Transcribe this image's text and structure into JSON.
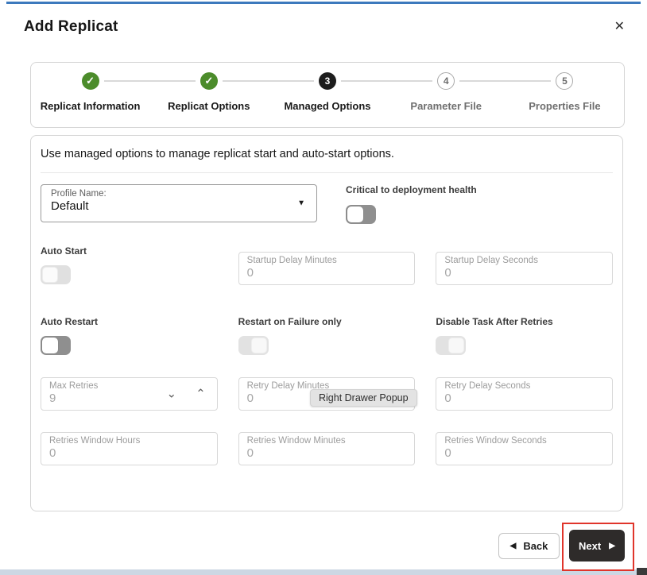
{
  "header": {
    "title": "Add Replicat"
  },
  "icons": {
    "close": "✕",
    "check": "✓",
    "dropdown_arrow": "▼",
    "chevron_down": "⌄",
    "chevron_up": "⌃",
    "back_arrow": "◀",
    "next_arrow": "▶"
  },
  "stepper": {
    "steps": [
      {
        "label": "Replicat Information",
        "glyph": "✓",
        "state": "complete"
      },
      {
        "label": "Replicat Options",
        "glyph": "✓",
        "state": "complete"
      },
      {
        "label": "Managed Options",
        "glyph": "3",
        "state": "current"
      },
      {
        "label": "Parameter File",
        "glyph": "4",
        "state": "future"
      },
      {
        "label": "Properties File",
        "glyph": "5",
        "state": "future"
      }
    ]
  },
  "form": {
    "description": "Use managed options to manage replicat start and auto-start options.",
    "profile": {
      "label": "Profile Name:",
      "value": "Default"
    },
    "critical": {
      "label": "Critical to deployment health",
      "state": "off"
    },
    "auto_start": {
      "label": "Auto Start",
      "state": "off",
      "enabled": false
    },
    "startup_delay_minutes": {
      "label": "Startup Delay Minutes",
      "value": "0",
      "enabled": false
    },
    "startup_delay_seconds": {
      "label": "Startup Delay Seconds",
      "value": "0",
      "enabled": false
    },
    "auto_restart": {
      "label": "Auto Restart",
      "state": "off",
      "enabled": true
    },
    "restart_on_failure": {
      "label": "Restart on Failure only",
      "state": "on",
      "enabled": false
    },
    "disable_task": {
      "label": "Disable Task After Retries",
      "state": "on",
      "enabled": false
    },
    "max_retries": {
      "label": "Max Retries",
      "value": "9",
      "enabled": false
    },
    "retry_delay_minutes": {
      "label": "Retry Delay Minutes",
      "value": "0",
      "enabled": false
    },
    "retry_delay_seconds": {
      "label": "Retry Delay Seconds",
      "value": "0",
      "enabled": false
    },
    "retries_window_hours": {
      "label": "Retries Window Hours",
      "value": "0",
      "enabled": false
    },
    "retries_window_minutes": {
      "label": "Retries Window Minutes",
      "value": "0",
      "enabled": false
    },
    "retries_window_seconds": {
      "label": "Retries Window Seconds",
      "value": "0",
      "enabled": false
    }
  },
  "tooltip": {
    "text": "Right Drawer Popup"
  },
  "footer": {
    "back_label": "Back",
    "next_label": "Next"
  },
  "colors": {
    "accent_blue": "#3c79bd",
    "step_complete_green": "#4c8c2b",
    "step_current_black": "#1d1d1d",
    "highlight_red": "#e0352b",
    "next_button_bg": "#2e2b2a",
    "bottom_strip": "#ccd7e3"
  }
}
